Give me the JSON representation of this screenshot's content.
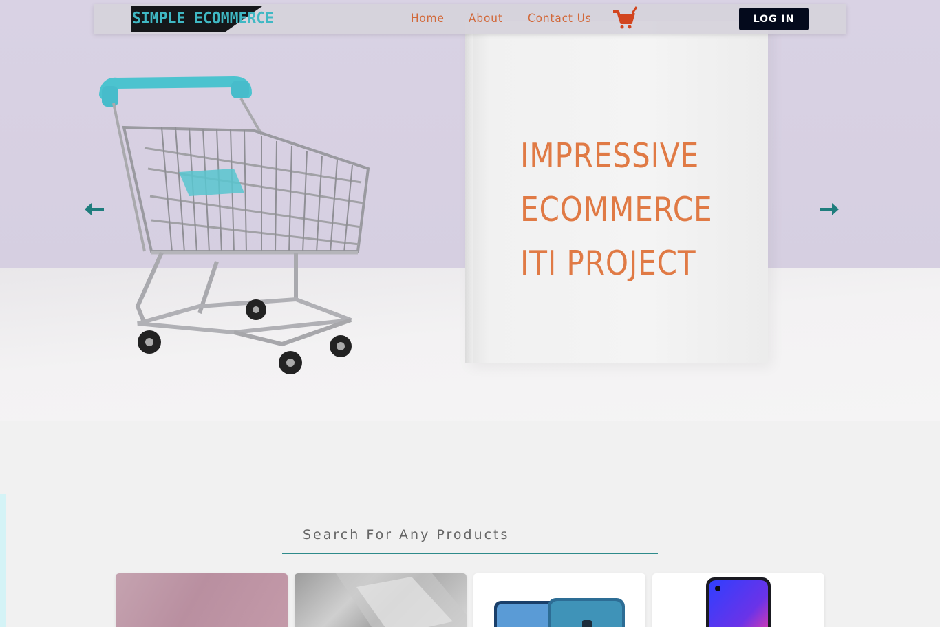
{
  "navbar": {
    "brand": "SIMPLE ECOMMERCE",
    "links": {
      "home": "Home",
      "about": "About",
      "contact": "Contact Us"
    },
    "cart_icon": "shopping-cart-icon",
    "login_label": "LOG IN"
  },
  "hero": {
    "lines": [
      "IMPRESSIVE",
      "ECOMMERCE",
      "ITI PROJECT"
    ],
    "prev_icon": "arrow-left-icon",
    "next_icon": "arrow-right-icon"
  },
  "search": {
    "placeholder": "Search For Any Products",
    "value": ""
  },
  "colors": {
    "accent": "#d2693a",
    "brand_text": "#3fb8c4",
    "teal": "#2e8b8b",
    "login_bg": "#040a1c"
  },
  "products": [
    {
      "image": "pink-product-image"
    },
    {
      "image": "silver-product-image"
    },
    {
      "image": "blue-phones-image"
    },
    {
      "image": "smartphone-image"
    }
  ]
}
